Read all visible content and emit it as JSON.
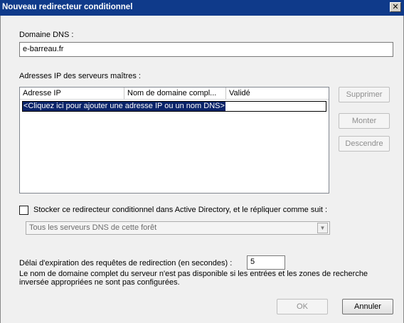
{
  "window": {
    "title": "Nouveau redirecteur conditionnel",
    "close_label": "✕"
  },
  "dns_domain": {
    "label": "Domaine DNS :",
    "value": "e-barreau.fr"
  },
  "master_servers": {
    "label": "Adresses IP des serveurs maîtres :",
    "columns": [
      "Adresse IP",
      "Nom de domaine compl...",
      "Validé"
    ],
    "placeholder_row": "<Cliquez ici pour ajouter une adresse IP ou un nom DNS>",
    "buttons": {
      "delete": "Supprimer",
      "up": "Monter",
      "down": "Descendre"
    }
  },
  "store_in_ad": {
    "label": "Stocker ce redirecteur conditionnel dans Active Directory, et le répliquer comme suit :",
    "checked": false,
    "replication_option": "Tous les serveurs DNS de cette forêt",
    "arrow_label": "▼"
  },
  "timeout": {
    "label": "Délai d'expiration des requêtes de redirection (en secondes) :",
    "value": "5"
  },
  "info_note": "Le nom de domaine complet du serveur n'est pas disponible si les entrées et les zones de recherche inversée appropriées ne sont pas configurées.",
  "actions": {
    "ok": "OK",
    "cancel": "Annuler"
  }
}
